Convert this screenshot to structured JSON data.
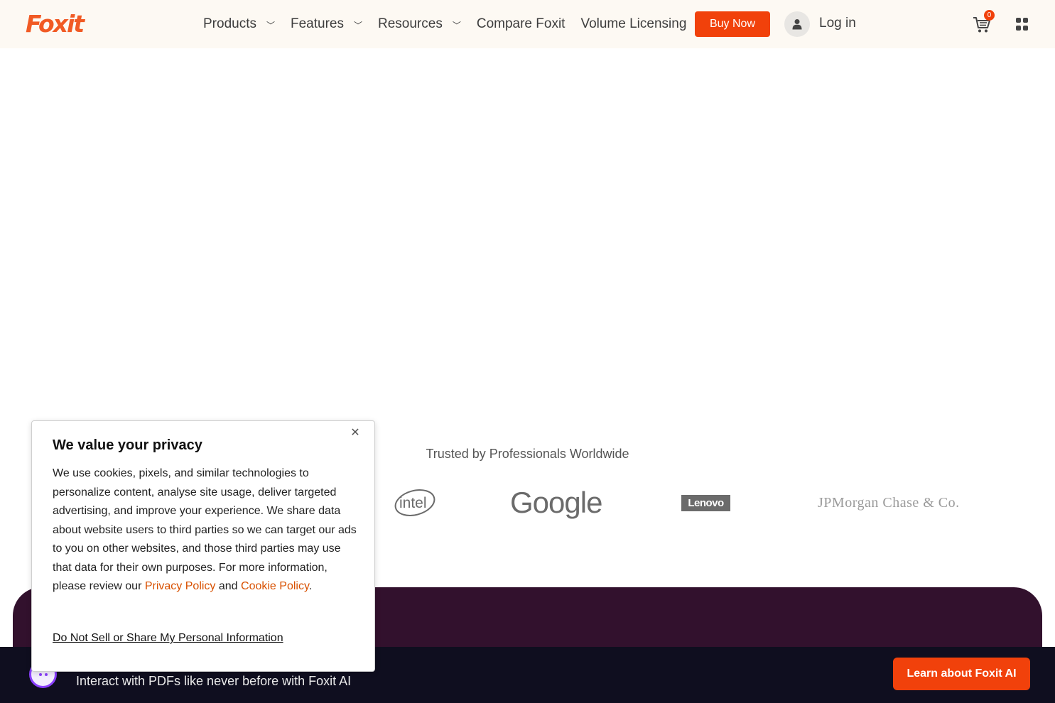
{
  "header": {
    "logo_text": "Foxit",
    "nav": [
      {
        "label": "Products",
        "has_dropdown": true
      },
      {
        "label": "Features",
        "has_dropdown": true
      },
      {
        "label": "Resources",
        "has_dropdown": true
      },
      {
        "label": "Compare Foxit",
        "has_dropdown": false
      },
      {
        "label": "Volume Licensing",
        "has_dropdown": false
      }
    ],
    "buy_now": "Buy Now",
    "login": "Log in",
    "cart_count": "0",
    "icons": {
      "user": "user-icon",
      "cart": "cart-icon",
      "apps": "apps-grid-icon",
      "chevron": "chevron-down-icon"
    }
  },
  "trusted": {
    "heading": "Trusted by Professionals Worldwide",
    "logos": [
      "intel",
      "Google",
      "Lenovo",
      "JPMorgan Chase & Co."
    ]
  },
  "privacy": {
    "title": "We value your privacy",
    "body_before": "We use cookies, pixels, and similar technologies to personalize content, analyse site usage, deliver targeted advertising, and improve your experience. We share data about website users to third parties so we can target our ads to you on other websites, and those third parties may use that data for their own purposes. For more information, please review our ",
    "privacy_link": "Privacy Policy",
    "and": " and ",
    "cookie_link": "Cookie Policy",
    "period": ".",
    "dns_link": "Do Not Sell or Share My Personal Information",
    "close_icon": "close-icon"
  },
  "promo": {
    "text": "Interact with PDFs like never before with Foxit AI",
    "button": "Learn about Foxit AI"
  },
  "colors": {
    "brand_orange": "#f1410b",
    "header_bg": "#fdf9f3",
    "panel_purple": "#32112d",
    "bottom_bar": "#0f0e1f"
  }
}
